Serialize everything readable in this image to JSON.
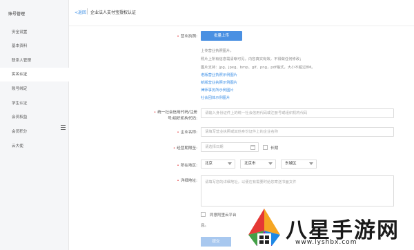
{
  "sidebar": {
    "title": "账号管理",
    "items": [
      {
        "label": "安全设置",
        "active": false
      },
      {
        "label": "基本资料",
        "active": false
      },
      {
        "label": "联系人管理",
        "active": false
      },
      {
        "label": "实名认证",
        "active": true
      },
      {
        "label": "账号绑定",
        "active": false
      },
      {
        "label": "学生认证",
        "active": false
      },
      {
        "label": "会员权益",
        "active": false
      },
      {
        "label": "会员积分",
        "active": false
      },
      {
        "label": "云大使",
        "active": false
      }
    ]
  },
  "header": {
    "back": "<返回",
    "title": "企业法人支付宝授权认证"
  },
  "form": {
    "license_label": "营业执照:",
    "upload_button": "批量上传",
    "help_lines": [
      "上传营业执照图片，",
      "照片上所有信息需清晰可见，内容真实有效，不得做任何修改；",
      "图片支持：jpg、jpeg、bmp、gif、png，pdf格式，大小不超过8M。"
    ],
    "example_links": [
      "老版营业执照示例图片",
      "新版营业执照示例图片",
      "律师事务所示例图片",
      "社会团体示例图片"
    ],
    "credit_code_label_1": "统一社会信用代码/注册",
    "credit_code_label_2": "号/组织机构代码:",
    "credit_code_placeholder": "请输入身份证件上的统一社会信用代码或注册号或组织机构代码",
    "company_label": "企业名称:",
    "company_placeholder": "请填写营业执照或其他身份证件上的企业名称",
    "period_label": "经营期限至:",
    "date_placeholder": "请选择日期",
    "longterm_label": "长期",
    "region_label": "所在地区:",
    "province": "北京",
    "city": "北京市",
    "district": "东城区",
    "address_label": "详细地址:",
    "address_placeholder": "请填写您的详细地址，以便在有需要时给您寄送书面文件",
    "agree_text": "同意阿里云平台",
    "agree_text2": "且。",
    "submit_button": "提交"
  },
  "watermark": {
    "text": "八星手游网",
    "url": "www.lyshbx.com"
  }
}
